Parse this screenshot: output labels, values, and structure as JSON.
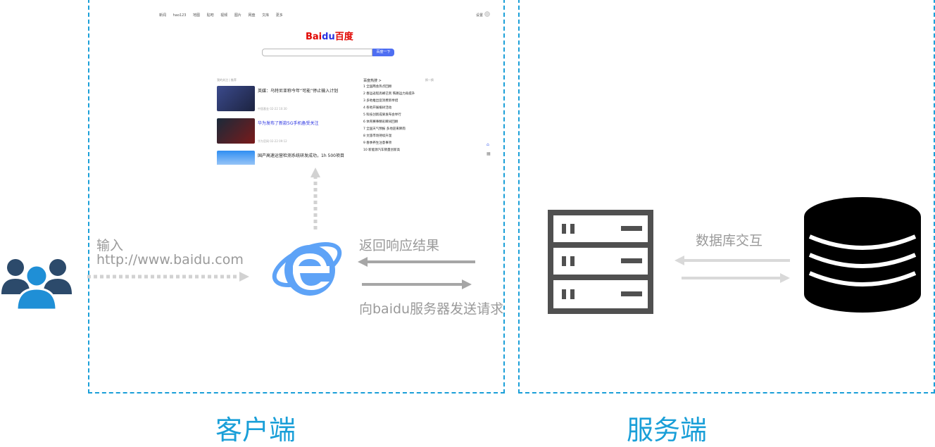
{
  "zones": {
    "client_label": "客户端",
    "server_label": "服务端"
  },
  "user": {
    "input_label": "输入",
    "url": "http://www.baidu.com"
  },
  "arrows": {
    "response_label": "返回响应结果",
    "request_label": "向baidu服务器发送请求",
    "db_label": "数据库交互"
  },
  "browser_page": {
    "nav_links": [
      "新闻",
      "hao123",
      "地图",
      "贴吧",
      "视频",
      "图片",
      "网盘",
      "文库",
      "更多"
    ],
    "right_nav": "设置",
    "logo_bai": "Bai",
    "logo_du": "du",
    "logo_cn": "百度",
    "search_button": "百度一下",
    "feed_header": "我的关注 | 推荐",
    "news": [
      {
        "title": "英媒：乌特尼亚称今年“可能”停止输入计划",
        "meta": "中国基金 02-22 10:30"
      },
      {
        "title": "华为发布了新款5G手机备受关注",
        "meta": "华为官网 02-22 09:12"
      },
      {
        "title": "国产高速运营检测系统研发成功，1h 500项目",
        "meta": ""
      }
    ],
    "hot_header": "百度热搜 >",
    "hot_more": "换一换",
    "hot_items": [
      "1 全国两会热点回顾",
      "2 春运返程高峰已到 铁路运力再提升",
      "3 多地推出促消费新举措",
      "4 各地开展植树活动",
      "5 科技创新成果发布会举行",
      "6 体育赛事精彩瞬间回顾",
      "7 全国天气预报 多地迎来降雨",
      "8 文旅市场持续升温",
      "9 春季养生注意事项",
      "10 新能源汽车销量创新高"
    ]
  },
  "colors": {
    "accent_blue": "#1a9fd8",
    "arrow_gray": "#a6a6a6",
    "ie_blue": "#5ea3f7",
    "server_gray": "#505050"
  },
  "icons": [
    "users-icon",
    "ie-browser-icon",
    "server-rack-icon",
    "database-icon"
  ]
}
